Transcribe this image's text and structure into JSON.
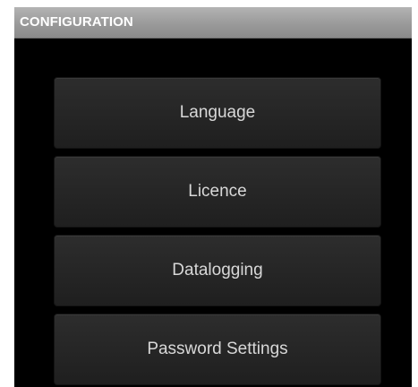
{
  "header": {
    "title": "CONFIGURATION"
  },
  "menu": {
    "items": [
      {
        "label": "Language"
      },
      {
        "label": "Licence"
      },
      {
        "label": "Datalogging"
      },
      {
        "label": "Password Settings"
      }
    ]
  },
  "colors": {
    "background": "#000000",
    "titlebar": "#9a9a9a",
    "button": "#262626",
    "button_text": "#d8d8d8"
  }
}
